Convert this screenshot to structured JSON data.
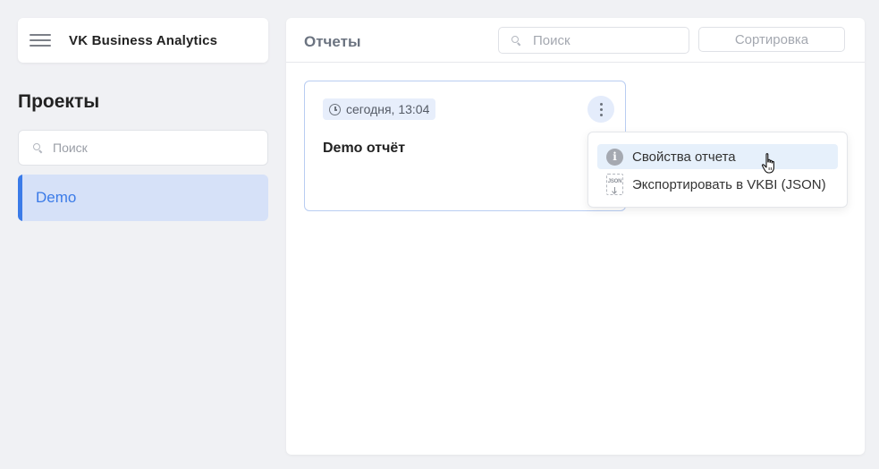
{
  "brand": {
    "name": "VK Business Analytics"
  },
  "sidebar": {
    "title": "Проекты",
    "search_placeholder": "Поиск",
    "projects": [
      {
        "label": "Demo",
        "selected": true
      }
    ]
  },
  "main": {
    "title": "Отчеты",
    "search_placeholder": "Поиск",
    "sort_label": "Сортировка"
  },
  "report": {
    "date": "сегодня, 13:04",
    "name": "Demo отчёт"
  },
  "context_menu": {
    "items": [
      {
        "label": "Свойства отчета",
        "icon": "info-icon",
        "active": true
      },
      {
        "label": "Экспортировать в VKBI (JSON)",
        "icon": "json-export-icon",
        "active": false
      }
    ],
    "json_icon_text": "JSON"
  },
  "colors": {
    "accent": "#3b7be8",
    "selected_bg": "#d6e1f8",
    "card_border": "#b9cdf2",
    "menu_hover": "#e6f0fb"
  }
}
